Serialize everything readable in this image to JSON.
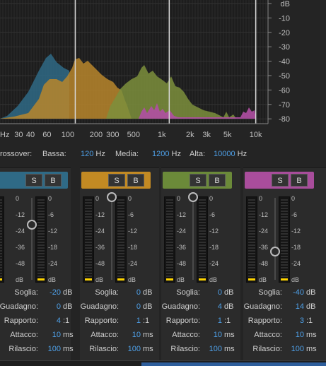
{
  "spectrum": {
    "db_labels": [
      "dB",
      "-10",
      "-20",
      "-30",
      "-40",
      "-50",
      "-60",
      "-70",
      "-80"
    ],
    "hz_labels": [
      "Hz",
      "30",
      "40",
      "60",
      "100",
      "200",
      "300",
      "500",
      "1k",
      "2k",
      "3k",
      "5k",
      "10k"
    ],
    "crossover_marker_hz": [
      120,
      1200,
      10000
    ]
  },
  "crossover": {
    "label": "rossover:",
    "low_label": "Bassa:",
    "low_value": "120",
    "low_unit": "Hz",
    "mid_label": "Media:",
    "mid_value": "1200",
    "mid_unit": "Hz",
    "high_label": "Alta:",
    "high_value": "10000",
    "high_unit": "Hz"
  },
  "band_common": {
    "solo_label": "S",
    "bypass_label": "B",
    "left_scale": [
      "0",
      "-12",
      "-24",
      "-36",
      "-48",
      "dB"
    ],
    "right_scale": [
      "0",
      "-6",
      "-12",
      "-18",
      "-24",
      "dB"
    ],
    "labels": {
      "threshold": "Soglia:",
      "gain": "Guadagno:",
      "ratio": "Rapporto:",
      "attack": "Attacco:",
      "release": "Rilascio:"
    },
    "units": {
      "threshold": "dB",
      "gain": "dB",
      "ratio": ":1",
      "attack": "ms",
      "release": "ms"
    }
  },
  "bands": [
    {
      "color": "#2f6a86",
      "threshold": "-20",
      "gain": "0",
      "ratio": "4",
      "attack": "10",
      "release": "100",
      "threshold_level_db": -20
    },
    {
      "color": "#c38a23",
      "threshold": "0",
      "gain": "0",
      "ratio": "1",
      "attack": "10",
      "release": "100",
      "threshold_level_db": 0
    },
    {
      "color": "#6b8a39",
      "threshold": "0",
      "gain": "4",
      "ratio": "1",
      "attack": "10",
      "release": "100",
      "threshold_level_db": 0
    },
    {
      "color": "#a94d9c",
      "threshold": "-40",
      "gain": "14",
      "ratio": "3",
      "attack": "10",
      "release": "100",
      "threshold_level_db": -40
    }
  ]
}
